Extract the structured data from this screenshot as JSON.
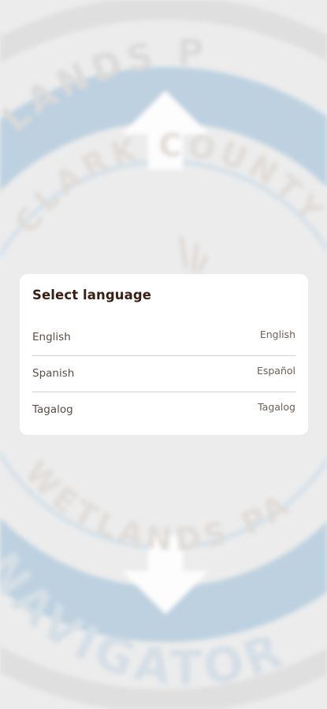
{
  "background": {
    "seal_top_text": "LANDS P",
    "seal_middle_text": "CLARK COUNTY",
    "seal_lower_text": "WETLANDS PARK",
    "seal_bottom_text": "NAVIGATOR",
    "colors": {
      "ring": "#b9cfdf",
      "text_light": "#dddddd",
      "page": "#ececec"
    }
  },
  "dialog": {
    "title": "Select language",
    "options": [
      {
        "name": "English",
        "native": "English"
      },
      {
        "name": "Spanish",
        "native": "Español"
      },
      {
        "name": "Tagalog",
        "native": "Tagalog"
      }
    ]
  }
}
